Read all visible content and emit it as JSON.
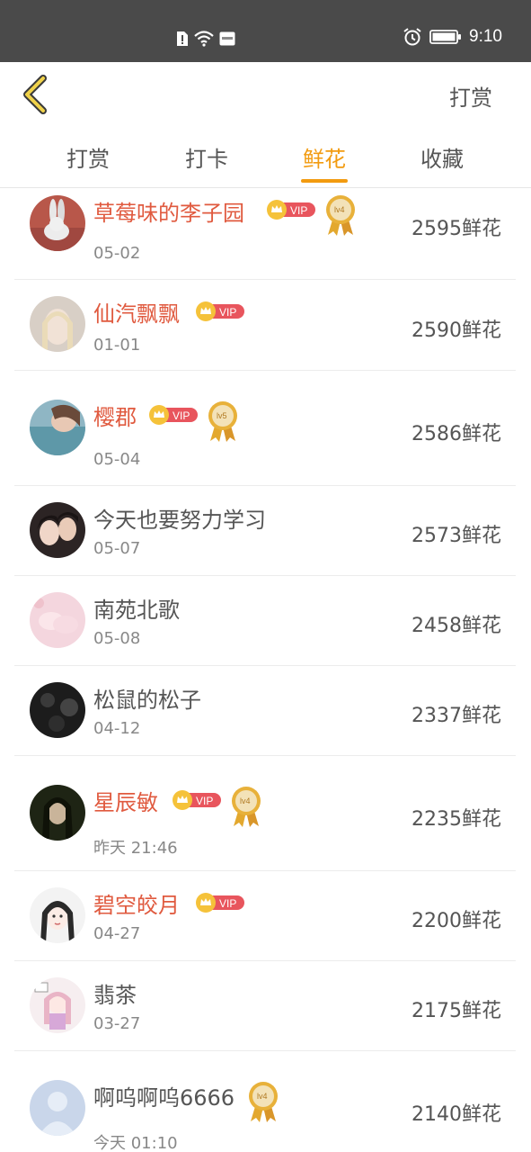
{
  "status_bar": {
    "time": "9:10"
  },
  "header": {
    "action_label": "打赏"
  },
  "tabs": [
    {
      "label": "打赏",
      "active": false
    },
    {
      "label": "打卡",
      "active": false
    },
    {
      "label": "鲜花",
      "active": true
    },
    {
      "label": "收藏",
      "active": false
    }
  ],
  "badge": {
    "vip_text": "VIP",
    "lv4": "lv4",
    "lv5": "lv5"
  },
  "colors": {
    "accent": "#f29b10",
    "vip_name": "#e05a3f",
    "vip_pill": "#e8555d"
  },
  "entries": [
    {
      "name": "草莓味的李子园",
      "date": "05-02",
      "amount": "2595鲜花",
      "vip": true,
      "level": "lv4",
      "avatar": "bunny-avatar"
    },
    {
      "name": "仙汽飘飘",
      "date": "01-01",
      "amount": "2590鲜花",
      "vip": true,
      "level": null,
      "avatar": "girl-portrait-avatar"
    },
    {
      "name": "樱郡",
      "date": "05-04",
      "amount": "2586鲜花",
      "vip": true,
      "level": "lv5",
      "avatar": "sea-avatar"
    },
    {
      "name": "今天也要努力学习",
      "date": "05-07",
      "amount": "2573鲜花",
      "vip": false,
      "level": null,
      "avatar": "couple-avatar"
    },
    {
      "name": "南苑北歌",
      "date": "05-08",
      "amount": "2458鲜花",
      "vip": false,
      "level": null,
      "avatar": "pink-hands-avatar"
    },
    {
      "name": "松鼠的松子",
      "date": "04-12",
      "amount": "2337鲜花",
      "vip": false,
      "level": null,
      "avatar": "dark-avatar"
    },
    {
      "name": "星辰敏",
      "date": "昨天 21:46",
      "amount": "2235鲜花",
      "vip": true,
      "level": "lv4",
      "avatar": "dark-green-avatar"
    },
    {
      "name": "碧空皎月",
      "date": "04-27",
      "amount": "2200鲜花",
      "vip": true,
      "level": null,
      "avatar": "sketch-girl-avatar"
    },
    {
      "name": "翡茶",
      "date": "03-27",
      "amount": "2175鲜花",
      "vip": false,
      "level": null,
      "avatar": "cartoon-girl-avatar"
    },
    {
      "name": "啊呜啊呜6666",
      "date": "今天 01:10",
      "amount": "2140鲜花",
      "vip": false,
      "level": "lv4",
      "avatar": "default-avatar"
    }
  ]
}
